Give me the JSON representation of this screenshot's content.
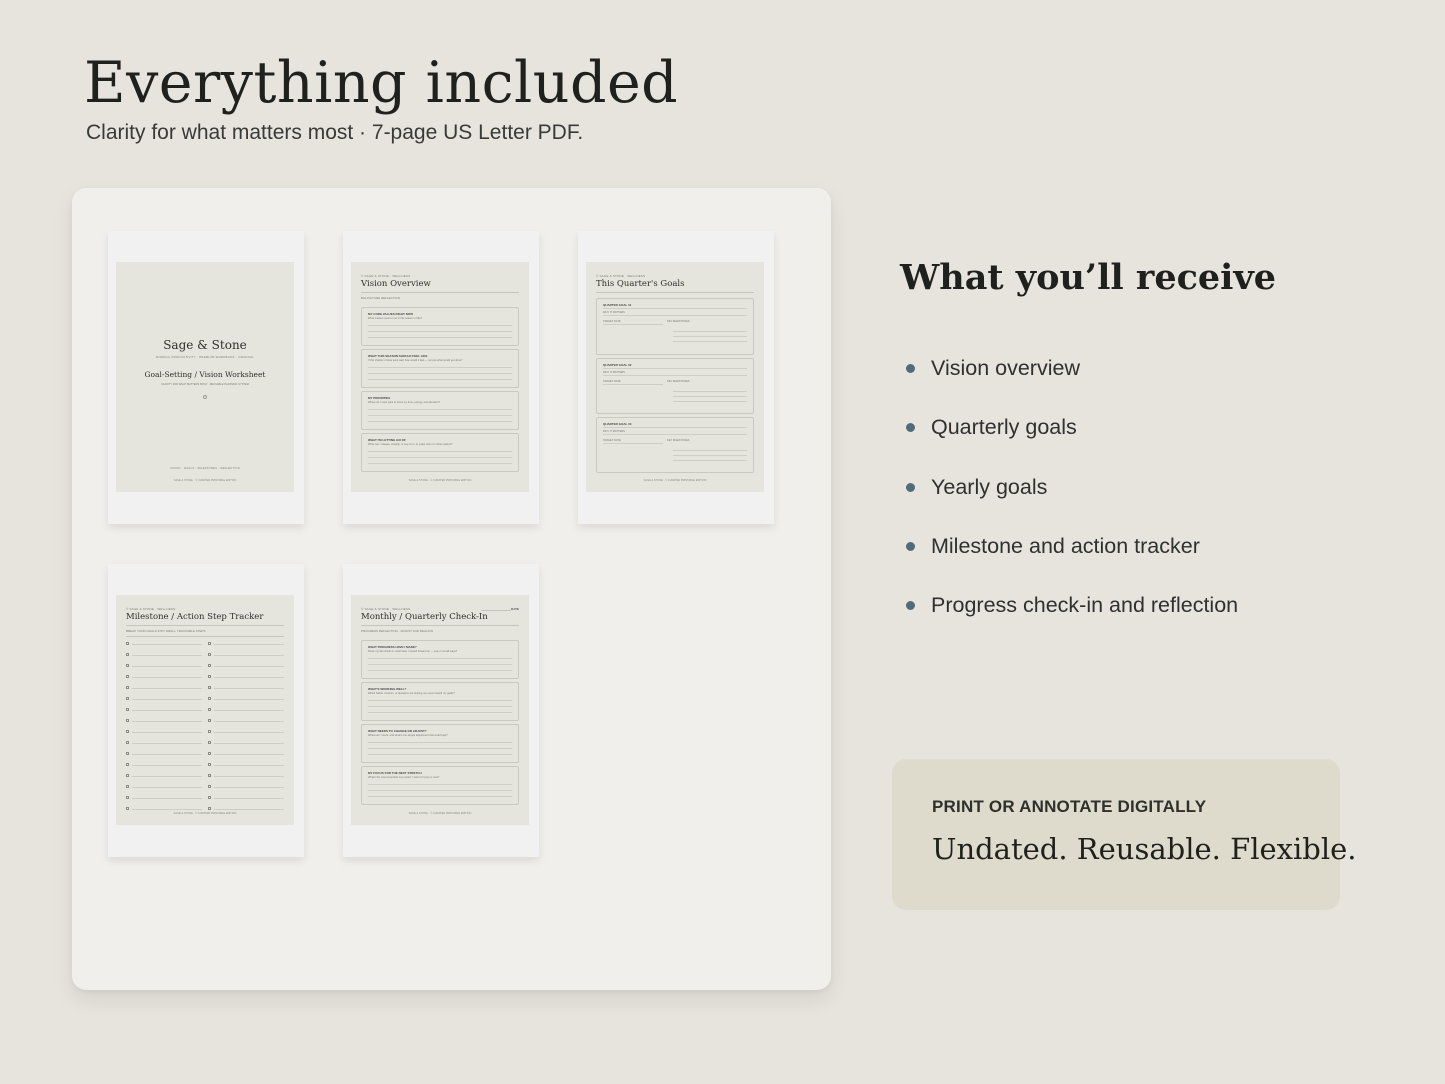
{
  "header": {
    "title": "Everything included",
    "subtitle": "Clarity for what matters most · 7-page US Letter PDF."
  },
  "pages": {
    "cover": {
      "brand": "Sage & Stone",
      "tagline": "MINDFUL PRODUCTIVITY · PREMIUM WORKBOOK · ORIGINAL",
      "doc_title": "Goal-Setting / Vision Worksheet",
      "doc_subtitle": "CLARITY FOR WHAT MATTERS MOST · REUSABLE PLANNING SYSTEM",
      "sections": "VISION · GOALS · MILESTONES · REFLECTION",
      "footer": "SAGE & STONE · © CURATED PRINTABLE EDITION"
    },
    "vision": {
      "brand": "© SAGE & STONE · WELLNESS",
      "title": "Vision Overview",
      "sub": "BIG PICTURE REFLECTION",
      "prompts": [
        {
          "label": "MY CORE VALUES RIGHT NOW",
          "hint": "What matters most to me in this season of life?"
        },
        {
          "label": "WHAT THIS SEASON SHOULD FEEL LIKE",
          "hint": "If this chapter of time went well, how would it feel — not just what would get done?"
        },
        {
          "label": "MY PRIORITIES",
          "hint": "Where do I most want to focus my time, energy, and attention?"
        },
        {
          "label": "WHAT I'M LETTING GO OF",
          "hint": "What can I release, simplify, or say no to, to make room for what matters?"
        }
      ],
      "footer": "SAGE & STONE · © CURATED PRINTABLE EDITION"
    },
    "quarter": {
      "brand": "© SAGE & STONE · WELLNESS",
      "title": "This Quarter's Goals",
      "goals": [
        {
          "label": "QUARTER GOAL #1",
          "why": "WHY IT MATTERS",
          "date": "TARGET DATE",
          "actions": "KEY MILESTONES"
        },
        {
          "label": "QUARTER GOAL #2",
          "why": "WHY IT MATTERS",
          "date": "TARGET DATE",
          "actions": "KEY MILESTONES"
        },
        {
          "label": "QUARTER GOAL #3",
          "why": "WHY IT MATTERS",
          "date": "TARGET DATE",
          "actions": "KEY MILESTONES"
        }
      ],
      "footer": "SAGE & STONE · © CURATED PRINTABLE EDITION"
    },
    "milestone": {
      "brand": "© SAGE & STONE · WELLNESS",
      "title": "Milestone / Action Step Tracker",
      "sub": "BREAK YOUR GOALS INTO SMALL, TRACKABLE STEPS",
      "footer": "SAGE & STONE · © CURATED PRINTABLE EDITION"
    },
    "checkin": {
      "brand": "© SAGE & STONE · WELLNESS",
      "title": "Monthly / Quarterly Check-In",
      "date": "DATE",
      "sub": "PROGRESS REFLECTION · ADJUST AND REALIGN",
      "prompts": [
        {
          "label": "WHAT PROGRESS HAVE I MADE?",
          "hint": "Since my last check-in, what have I moved forward on — even in small ways?"
        },
        {
          "label": "WHAT'S WORKING WELL?",
          "hint": "Which habits, routines, or decisions are helping me move toward my goals?"
        },
        {
          "label": "WHAT NEEDS TO CHANGE OR ADJUST?",
          "hint": "Where am I stuck, and what's one simple adjustment that could help?"
        },
        {
          "label": "MY FOCUS FOR THE NEXT STRETCH",
          "hint": "What's the most important next action I want to focus on now?"
        }
      ],
      "footer": "SAGE & STONE · © CURATED PRINTABLE EDITION"
    }
  },
  "receive": {
    "title": "What you’ll receive",
    "items": [
      "Vision overview",
      "Quarterly goals",
      "Yearly goals",
      "Milestone and action tracker",
      "Progress check-in and reflection"
    ]
  },
  "callout": {
    "kicker": "PRINT OR ANNOTATE DIGITALLY",
    "text": "Undated. Reusable. Flexible."
  }
}
